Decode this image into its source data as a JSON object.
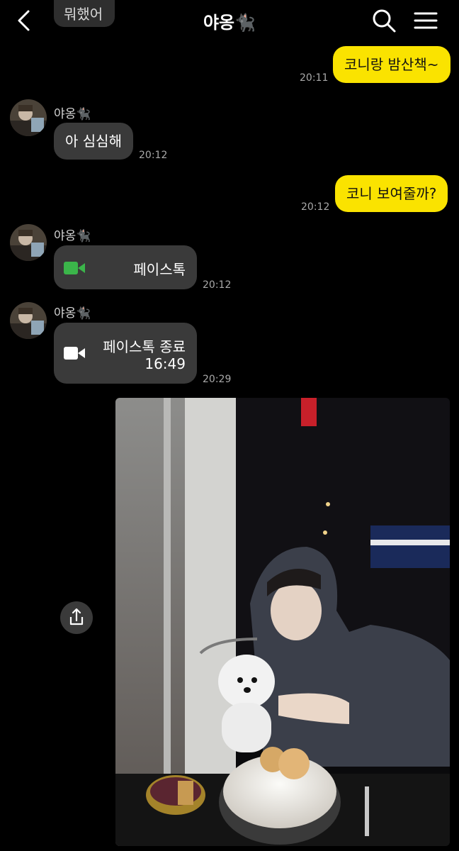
{
  "header": {
    "title": "야옹🐈‍⬛",
    "back_icon": "chevron-left-icon",
    "search_icon": "search-icon",
    "menu_icon": "hamburger-menu-icon"
  },
  "partial_message": {
    "text": "뭐했어"
  },
  "messages": [
    {
      "from": "me",
      "text": "코니랑 밤산책~",
      "time": "20:11"
    },
    {
      "from": "other",
      "sender": "야옹🐈‍⬛",
      "text": "아 심심해",
      "time": "20:12"
    },
    {
      "from": "me",
      "text": "코니 보여줄까?",
      "time": "20:12"
    },
    {
      "from": "other",
      "sender": "야옹🐈‍⬛",
      "call_label": "페이스톡",
      "time": "20:12",
      "icon": "video-camera-icon",
      "icon_color": "#3bb54a"
    },
    {
      "from": "other",
      "sender": "야옹🐈‍⬛",
      "call_label": "페이스톡 종료",
      "duration": "16:49",
      "time": "20:29",
      "icon": "video-camera-icon",
      "icon_color": "#ffffff"
    }
  ],
  "photo": {
    "share_icon": "share-icon"
  },
  "colors": {
    "my_bubble": "#fae300",
    "other_bubble": "#3a3a3a",
    "background": "#000000"
  }
}
